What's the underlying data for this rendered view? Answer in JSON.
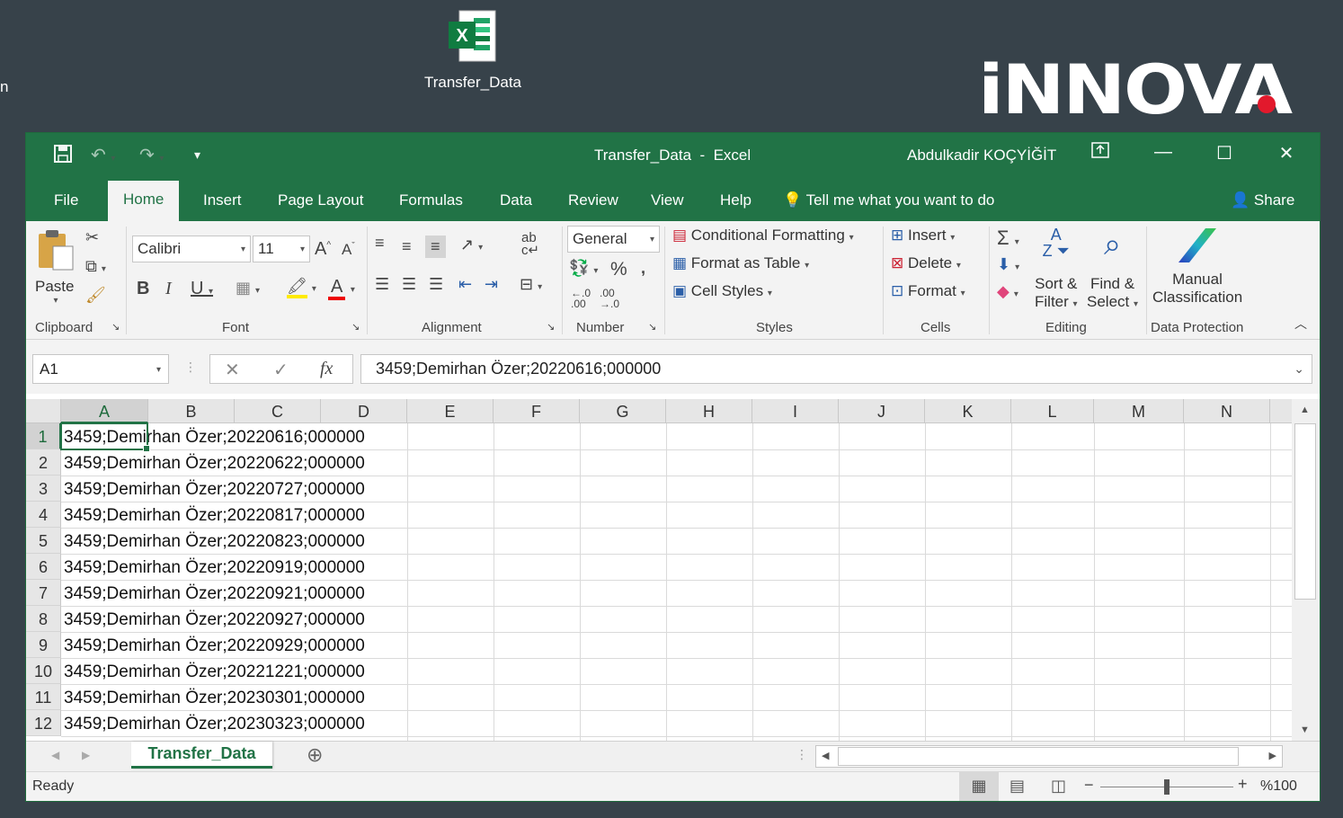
{
  "desktop": {
    "icon_label": "Transfer_Data",
    "left_partial_text": "n",
    "brand": "iNNOVA"
  },
  "window": {
    "title": "Transfer_Data  -  Excel",
    "user": "Abdulkadir KOÇYİĞİT",
    "accent": "#217346"
  },
  "tabs": [
    "File",
    "Home",
    "Insert",
    "Page Layout",
    "Formulas",
    "Data",
    "Review",
    "View",
    "Help"
  ],
  "tellme": "Tell me what you want to do",
  "share": "Share",
  "ribbon": {
    "paste": "Paste",
    "font_name": "Calibri",
    "font_size": "11",
    "number_format": "General",
    "conditional_formatting": "Conditional Formatting",
    "format_as_table": "Format as Table",
    "cell_styles": "Cell Styles",
    "insert": "Insert",
    "delete": "Delete",
    "format": "Format",
    "sort_filter_1": "Sort &",
    "sort_filter_2": "Filter",
    "find_select_1": "Find &",
    "find_select_2": "Select",
    "manual_1": "Manual",
    "manual_2": "Classification",
    "groups": {
      "clipboard": "Clipboard",
      "font": "Font",
      "alignment": "Alignment",
      "number": "Number",
      "styles": "Styles",
      "cells": "Cells",
      "editing": "Editing",
      "data_protection": "Data Protection"
    }
  },
  "formula_bar": {
    "name_box": "A1",
    "formula": "3459;Demirhan Özer;20220616;000000"
  },
  "columns": [
    "A",
    "B",
    "C",
    "D",
    "E",
    "F",
    "G",
    "H",
    "I",
    "J",
    "K",
    "L",
    "M",
    "N"
  ],
  "rows": [
    {
      "n": "1",
      "a": "3459;Demirhan Özer;20220616;000000"
    },
    {
      "n": "2",
      "a": "3459;Demirhan Özer;20220622;000000"
    },
    {
      "n": "3",
      "a": "3459;Demirhan Özer;20220727;000000"
    },
    {
      "n": "4",
      "a": "3459;Demirhan Özer;20220817;000000"
    },
    {
      "n": "5",
      "a": "3459;Demirhan Özer;20220823;000000"
    },
    {
      "n": "6",
      "a": "3459;Demirhan Özer;20220919;000000"
    },
    {
      "n": "7",
      "a": "3459;Demirhan Özer;20220921;000000"
    },
    {
      "n": "8",
      "a": "3459;Demirhan Özer;20220927;000000"
    },
    {
      "n": "9",
      "a": "3459;Demirhan Özer;20220929;000000"
    },
    {
      "n": "10",
      "a": "3459;Demirhan Özer;20221221;000000"
    },
    {
      "n": "11",
      "a": "3459;Demirhan Özer;20230301;000000"
    },
    {
      "n": "12",
      "a": "3459;Demirhan Özer;20230323;000000"
    }
  ],
  "sheet_tab": "Transfer_Data",
  "status": {
    "ready": "Ready",
    "zoom": "%100"
  }
}
